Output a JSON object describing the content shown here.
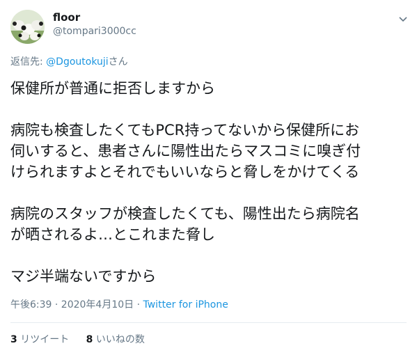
{
  "user": {
    "display_name": "floor",
    "handle": "@tompari3000cc"
  },
  "reply_to": {
    "prefix": "返信先: ",
    "mention": "@Dgoutokuji",
    "suffix": "さん"
  },
  "tweet": {
    "text": "保健所が普通に拒否しますから\n\n病院も検査したくてもPCR持ってないから保健所にお\n伺いすると、患者さんに陽性出たらマスコミに嗅ぎ付\nけられますよとそれでもいいならと脅しをかけてくる\n\n病院のスタッフが検査したくても、陽性出たら病院名\nが晒されるよ…とこれまた脅し\n\nマジ半端ないですから",
    "timestamp": "午後6:39 · 2020年4月10日",
    "separator": " · ",
    "source": "Twitter for iPhone"
  },
  "stats": {
    "retweets_count": "3",
    "retweets_label": " リツイート",
    "likes_count": "8",
    "likes_label": " いいねの数"
  },
  "colors": {
    "link": "#1b95e0",
    "muted": "#657786",
    "text": "#14171a",
    "divider": "#e6ecf0"
  },
  "icons": {
    "avatar": "avatar-sheep-image",
    "caret": "chevron-down-icon"
  }
}
